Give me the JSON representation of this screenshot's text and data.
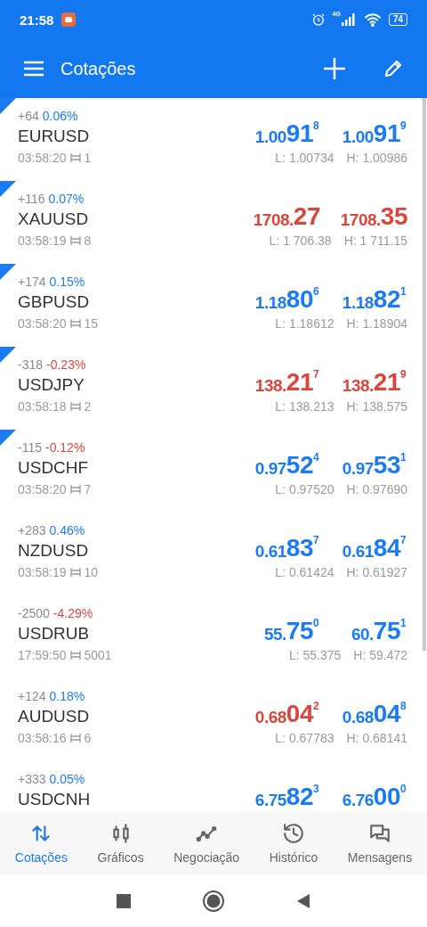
{
  "status_bar": {
    "time": "21:58",
    "network": "4G",
    "battery": "74"
  },
  "app_bar": {
    "title": "Cotações"
  },
  "quotes": [
    {
      "marked": true,
      "change": "+64",
      "percent": "0.06%",
      "percent_down": false,
      "symbol": "EURUSD",
      "time": "03:58:20",
      "spread": "1",
      "bid": {
        "head": "1.00",
        "big": "91",
        "sup": "8",
        "down": false
      },
      "ask": {
        "head": "1.00",
        "big": "91",
        "sup": "9",
        "down": false
      },
      "low": "L: 1.00734",
      "high": "H: 1.00986"
    },
    {
      "marked": true,
      "change": "+116",
      "percent": "0.07%",
      "percent_down": false,
      "symbol": "XAUUSD",
      "time": "03:58:19",
      "spread": "8",
      "bid": {
        "head": "1708.",
        "big": "27",
        "down": true
      },
      "ask": {
        "head": "1708.",
        "big": "35",
        "down": true
      },
      "low": "L: 1 706.38",
      "high": "H: 1 711.15"
    },
    {
      "marked": true,
      "change": "+174",
      "percent": "0.15%",
      "percent_down": false,
      "symbol": "GBPUSD",
      "time": "03:58:20",
      "spread": "15",
      "bid": {
        "head": "1.18",
        "big": "80",
        "sup": "6",
        "down": false
      },
      "ask": {
        "head": "1.18",
        "big": "82",
        "sup": "1",
        "down": false
      },
      "low": "L: 1.18612",
      "high": "H: 1.18904"
    },
    {
      "marked": true,
      "change": "-318",
      "percent": "-0.23%",
      "percent_down": true,
      "symbol": "USDJPY",
      "time": "03:58:18",
      "spread": "2",
      "bid": {
        "head": "138.",
        "big": "21",
        "sup": "7",
        "down": true
      },
      "ask": {
        "head": "138.",
        "big": "21",
        "sup": "9",
        "down": true
      },
      "low": "L: 138.213",
      "high": "H: 138.575"
    },
    {
      "marked": true,
      "change": "-115",
      "percent": "-0.12%",
      "percent_down": true,
      "symbol": "USDCHF",
      "time": "03:58:20",
      "spread": "7",
      "bid": {
        "head": "0.97",
        "big": "52",
        "sup": "4",
        "down": false
      },
      "ask": {
        "head": "0.97",
        "big": "53",
        "sup": "1",
        "down": false
      },
      "low": "L: 0.97520",
      "high": "H: 0.97690"
    },
    {
      "marked": false,
      "change": "+283",
      "percent": "0.46%",
      "percent_down": false,
      "symbol": "NZDUSD",
      "time": "03:58:19",
      "spread": "10",
      "bid": {
        "head": "0.61",
        "big": "83",
        "sup": "7",
        "down": false
      },
      "ask": {
        "head": "0.61",
        "big": "84",
        "sup": "7",
        "down": false
      },
      "low": "L: 0.61424",
      "high": "H: 0.61927"
    },
    {
      "marked": false,
      "change": "-2500",
      "percent": "-4.29%",
      "percent_down": true,
      "symbol": "USDRUB",
      "time": "17:59:50",
      "spread": "5001",
      "bid": {
        "head": "55.",
        "big": "75",
        "sup": "0",
        "down": false
      },
      "ask": {
        "head": "60.",
        "big": "75",
        "sup": "1",
        "down": false
      },
      "low": "L: 55.375",
      "high": "H: 59.472"
    },
    {
      "marked": false,
      "change": "+124",
      "percent": "0.18%",
      "percent_down": false,
      "symbol": "AUDUSD",
      "time": "03:58:16",
      "spread": "6",
      "bid": {
        "head": "0.68",
        "big": "04",
        "sup": "2",
        "down": true
      },
      "ask": {
        "head": "0.68",
        "big": "04",
        "sup": "8",
        "down": false
      },
      "low": "L: 0.67783",
      "high": "H: 0.68141"
    },
    {
      "marked": false,
      "change": "+333",
      "percent": "0.05%",
      "percent_down": false,
      "symbol": "USDCNH",
      "bid": {
        "head": "6.75",
        "big": "82",
        "sup": "3",
        "down": false
      },
      "ask": {
        "head": "6.76",
        "big": "00",
        "sup": "0",
        "down": false
      }
    }
  ],
  "tabs": [
    {
      "label": "Cotações",
      "kind": "quotes",
      "selected": true
    },
    {
      "label": "Gráficos",
      "kind": "charts",
      "selected": false
    },
    {
      "label": "Negociação",
      "kind": "trade",
      "selected": false
    },
    {
      "label": "Histórico",
      "kind": "history",
      "selected": false
    },
    {
      "label": "Mensagens",
      "kind": "messages",
      "selected": false
    }
  ]
}
